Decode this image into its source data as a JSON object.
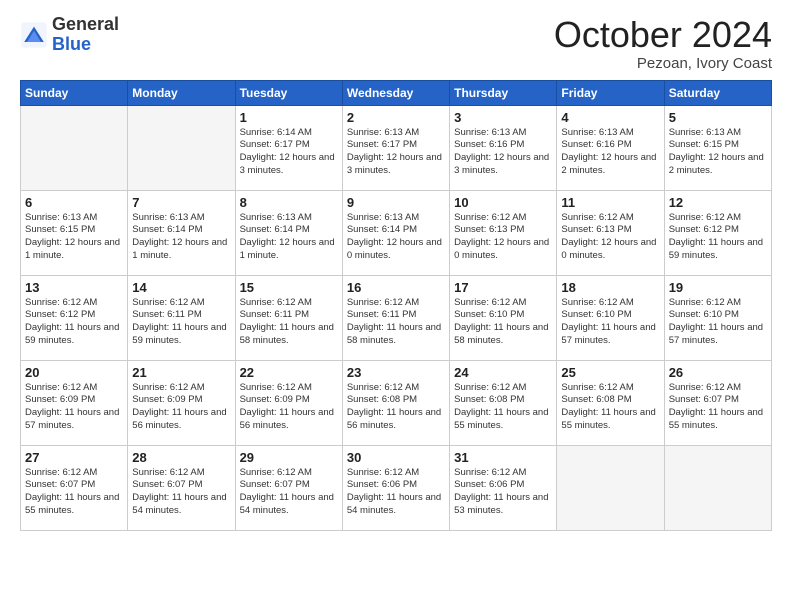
{
  "logo": {
    "general": "General",
    "blue": "Blue"
  },
  "header": {
    "month": "October 2024",
    "location": "Pezoan, Ivory Coast"
  },
  "weekdays": [
    "Sunday",
    "Monday",
    "Tuesday",
    "Wednesday",
    "Thursday",
    "Friday",
    "Saturday"
  ],
  "weeks": [
    [
      {
        "day": "",
        "info": ""
      },
      {
        "day": "",
        "info": ""
      },
      {
        "day": "1",
        "info": "Sunrise: 6:14 AM\nSunset: 6:17 PM\nDaylight: 12 hours and 3 minutes."
      },
      {
        "day": "2",
        "info": "Sunrise: 6:13 AM\nSunset: 6:17 PM\nDaylight: 12 hours and 3 minutes."
      },
      {
        "day": "3",
        "info": "Sunrise: 6:13 AM\nSunset: 6:16 PM\nDaylight: 12 hours and 3 minutes."
      },
      {
        "day": "4",
        "info": "Sunrise: 6:13 AM\nSunset: 6:16 PM\nDaylight: 12 hours and 2 minutes."
      },
      {
        "day": "5",
        "info": "Sunrise: 6:13 AM\nSunset: 6:15 PM\nDaylight: 12 hours and 2 minutes."
      }
    ],
    [
      {
        "day": "6",
        "info": "Sunrise: 6:13 AM\nSunset: 6:15 PM\nDaylight: 12 hours and 1 minute."
      },
      {
        "day": "7",
        "info": "Sunrise: 6:13 AM\nSunset: 6:14 PM\nDaylight: 12 hours and 1 minute."
      },
      {
        "day": "8",
        "info": "Sunrise: 6:13 AM\nSunset: 6:14 PM\nDaylight: 12 hours and 1 minute."
      },
      {
        "day": "9",
        "info": "Sunrise: 6:13 AM\nSunset: 6:14 PM\nDaylight: 12 hours and 0 minutes."
      },
      {
        "day": "10",
        "info": "Sunrise: 6:12 AM\nSunset: 6:13 PM\nDaylight: 12 hours and 0 minutes."
      },
      {
        "day": "11",
        "info": "Sunrise: 6:12 AM\nSunset: 6:13 PM\nDaylight: 12 hours and 0 minutes."
      },
      {
        "day": "12",
        "info": "Sunrise: 6:12 AM\nSunset: 6:12 PM\nDaylight: 11 hours and 59 minutes."
      }
    ],
    [
      {
        "day": "13",
        "info": "Sunrise: 6:12 AM\nSunset: 6:12 PM\nDaylight: 11 hours and 59 minutes."
      },
      {
        "day": "14",
        "info": "Sunrise: 6:12 AM\nSunset: 6:11 PM\nDaylight: 11 hours and 59 minutes."
      },
      {
        "day": "15",
        "info": "Sunrise: 6:12 AM\nSunset: 6:11 PM\nDaylight: 11 hours and 58 minutes."
      },
      {
        "day": "16",
        "info": "Sunrise: 6:12 AM\nSunset: 6:11 PM\nDaylight: 11 hours and 58 minutes."
      },
      {
        "day": "17",
        "info": "Sunrise: 6:12 AM\nSunset: 6:10 PM\nDaylight: 11 hours and 58 minutes."
      },
      {
        "day": "18",
        "info": "Sunrise: 6:12 AM\nSunset: 6:10 PM\nDaylight: 11 hours and 57 minutes."
      },
      {
        "day": "19",
        "info": "Sunrise: 6:12 AM\nSunset: 6:10 PM\nDaylight: 11 hours and 57 minutes."
      }
    ],
    [
      {
        "day": "20",
        "info": "Sunrise: 6:12 AM\nSunset: 6:09 PM\nDaylight: 11 hours and 57 minutes."
      },
      {
        "day": "21",
        "info": "Sunrise: 6:12 AM\nSunset: 6:09 PM\nDaylight: 11 hours and 56 minutes."
      },
      {
        "day": "22",
        "info": "Sunrise: 6:12 AM\nSunset: 6:09 PM\nDaylight: 11 hours and 56 minutes."
      },
      {
        "day": "23",
        "info": "Sunrise: 6:12 AM\nSunset: 6:08 PM\nDaylight: 11 hours and 56 minutes."
      },
      {
        "day": "24",
        "info": "Sunrise: 6:12 AM\nSunset: 6:08 PM\nDaylight: 11 hours and 55 minutes."
      },
      {
        "day": "25",
        "info": "Sunrise: 6:12 AM\nSunset: 6:08 PM\nDaylight: 11 hours and 55 minutes."
      },
      {
        "day": "26",
        "info": "Sunrise: 6:12 AM\nSunset: 6:07 PM\nDaylight: 11 hours and 55 minutes."
      }
    ],
    [
      {
        "day": "27",
        "info": "Sunrise: 6:12 AM\nSunset: 6:07 PM\nDaylight: 11 hours and 55 minutes."
      },
      {
        "day": "28",
        "info": "Sunrise: 6:12 AM\nSunset: 6:07 PM\nDaylight: 11 hours and 54 minutes."
      },
      {
        "day": "29",
        "info": "Sunrise: 6:12 AM\nSunset: 6:07 PM\nDaylight: 11 hours and 54 minutes."
      },
      {
        "day": "30",
        "info": "Sunrise: 6:12 AM\nSunset: 6:06 PM\nDaylight: 11 hours and 54 minutes."
      },
      {
        "day": "31",
        "info": "Sunrise: 6:12 AM\nSunset: 6:06 PM\nDaylight: 11 hours and 53 minutes."
      },
      {
        "day": "",
        "info": ""
      },
      {
        "day": "",
        "info": ""
      }
    ]
  ]
}
